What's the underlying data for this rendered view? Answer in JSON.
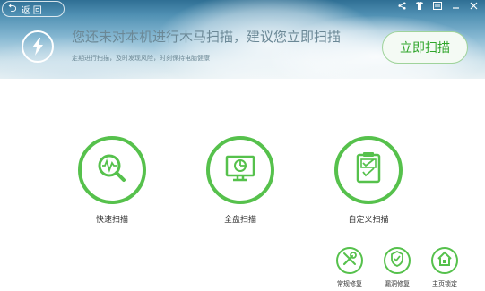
{
  "header": {
    "back_label": "返 回",
    "title": "您还未对本机进行木马扫描，建议您立即扫描",
    "subtitle": "定期进行扫描，及时发现风险，时刻保持电脑健康",
    "scan_now_label": "立即扫描"
  },
  "window_controls": {
    "share": "share-icon",
    "skin": "skin-icon",
    "menu": "menu-icon",
    "minimize": "minimize-icon",
    "close": "close-icon"
  },
  "scan_modes": [
    {
      "label": "快速扫描",
      "icon": "quick-scan-icon"
    },
    {
      "label": "全盘扫描",
      "icon": "full-scan-icon"
    },
    {
      "label": "自定义扫描",
      "icon": "custom-scan-icon"
    }
  ],
  "tools": [
    {
      "label": "常规修复",
      "icon": "wrench-screwdriver-icon"
    },
    {
      "label": "漏洞修复",
      "icon": "vulnerability-repair-icon"
    },
    {
      "label": "主页锁定",
      "icon": "home-lock-icon"
    }
  ],
  "colors": {
    "accent": "#56c14c",
    "accent_text": "#2fa52a"
  }
}
